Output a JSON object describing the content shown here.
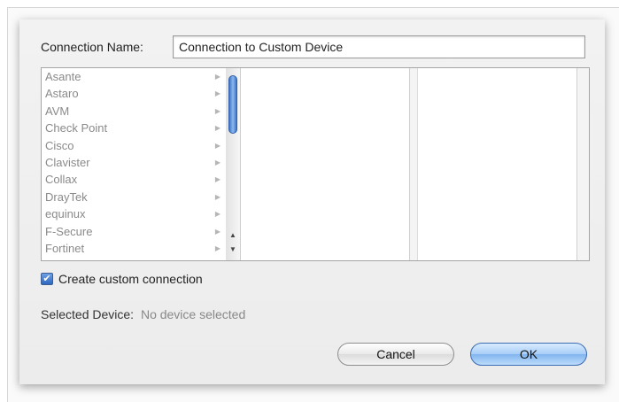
{
  "connection_name": {
    "label": "Connection Name:",
    "value": "Connection to Custom Device"
  },
  "vendors": [
    "Asante",
    "Astaro",
    "AVM",
    "Check Point",
    "Cisco",
    "Clavister",
    "Collax",
    "DrayTek",
    "equinux",
    "F-Secure",
    "Fortinet"
  ],
  "custom_connection": {
    "label": "Create custom connection",
    "checked": true
  },
  "selected_device": {
    "label": "Selected Device:",
    "value": "No device selected"
  },
  "buttons": {
    "cancel": "Cancel",
    "ok": "OK"
  },
  "colors": {
    "accent": "#3b76c9",
    "disabled_text": "#8a8a8a"
  }
}
